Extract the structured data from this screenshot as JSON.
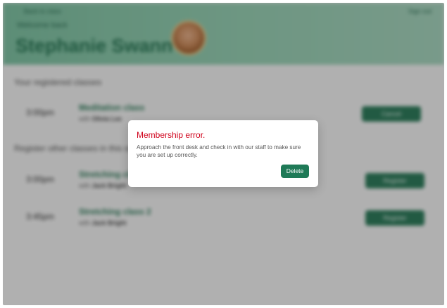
{
  "header": {
    "back_link": "Back to class",
    "signout_link": "Sign out",
    "welcome": "Welcome back",
    "member_name": "Stephanie Swann"
  },
  "sections": {
    "registered_title": "Your registered classes",
    "other_title": "Register other classes in this schedule"
  },
  "registered_classes": [
    {
      "time": "3:00pm",
      "title": "Meditation class",
      "instructor_prefix": "with",
      "instructor": "Olivia Lee",
      "action": "Cancel"
    }
  ],
  "other_classes": [
    {
      "time": "3:00pm",
      "title": "Stretching class",
      "instructor_prefix": "with",
      "instructor": "Jack Bright",
      "action": "Register"
    },
    {
      "time": "3:45pm",
      "title": "Stretching class 2",
      "instructor_prefix": "with",
      "instructor": "Jack Bright",
      "action": "Register"
    }
  ],
  "dialog": {
    "title": "Membership error.",
    "message": "Approach the front desk and check in with our staff to make sure you are set up correctly.",
    "button": "Delete"
  },
  "colors": {
    "header_green": "#8fcbaf",
    "accent_green": "#1f7a57",
    "error_red": "#d0021b"
  }
}
